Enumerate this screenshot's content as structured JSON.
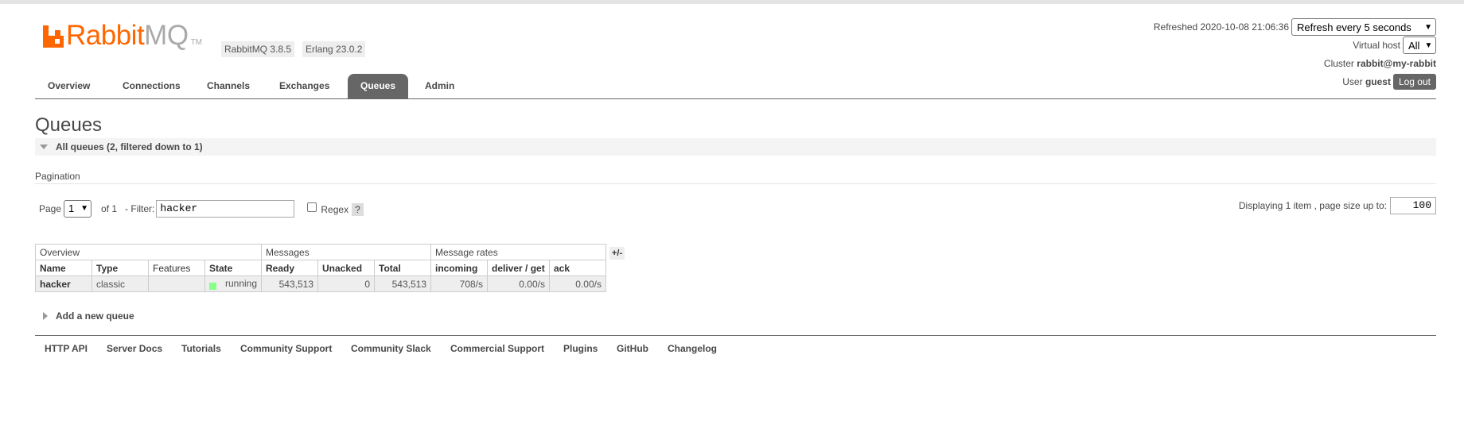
{
  "logo": {
    "brand_main": "Rabbit",
    "brand_suffix": "MQ",
    "tm": "TM"
  },
  "versions": {
    "rabbitmq": "RabbitMQ 3.8.5",
    "erlang": "Erlang 23.0.2"
  },
  "header_info": {
    "refreshed_label": "Refreshed 2020-10-08 21:06:36",
    "refresh_select": "Refresh every 5 seconds",
    "vhost_label": "Virtual host",
    "vhost_select": "All",
    "cluster_label": "Cluster",
    "cluster_name": "rabbit@my-rabbit",
    "user_label": "User",
    "user_name": "guest",
    "logout": "Log out"
  },
  "nav": {
    "tabs": [
      {
        "label": "Overview"
      },
      {
        "label": "Connections"
      },
      {
        "label": "Channels"
      },
      {
        "label": "Exchanges"
      },
      {
        "label": "Queues"
      },
      {
        "label": "Admin"
      }
    ],
    "active": "Queues"
  },
  "page": {
    "title": "Queues",
    "section_title": "All queues (2, filtered down to 1)"
  },
  "pagination": {
    "label": "Pagination",
    "page_label": "Page",
    "page_value": "1",
    "of_label": "of 1",
    "filter_label": "- Filter:",
    "filter_value": "hacker",
    "regex_label": "Regex",
    "help": "?",
    "display_label": "Displaying 1 item , page size up to:",
    "page_size": "100"
  },
  "table": {
    "groups": [
      "Overview",
      "Messages",
      "Message rates"
    ],
    "toggle": "+/-",
    "columns": [
      "Name",
      "Type",
      "Features",
      "State",
      "Ready",
      "Unacked",
      "Total",
      "incoming",
      "deliver / get",
      "ack"
    ],
    "rows": [
      {
        "name": "hacker",
        "type": "classic",
        "features": "",
        "state": "running",
        "ready": "543,513",
        "unacked": "0",
        "total": "543,513",
        "incoming": "708/s",
        "deliver_get": "0.00/s",
        "ack": "0.00/s"
      }
    ]
  },
  "add_queue": "Add a new queue",
  "footer": {
    "links": [
      "HTTP API",
      "Server Docs",
      "Tutorials",
      "Community Support",
      "Community Slack",
      "Commercial Support",
      "Plugins",
      "GitHub",
      "Changelog"
    ]
  },
  "colors": {
    "brand": "#ff6600",
    "running": "#88ff88",
    "tab_active": "#666666"
  }
}
